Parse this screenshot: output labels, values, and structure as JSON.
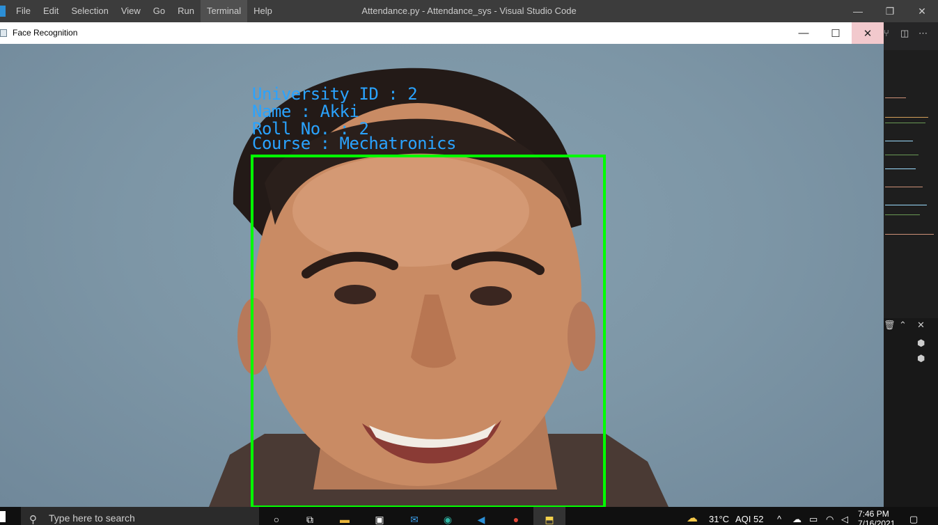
{
  "vscode": {
    "menu": [
      "File",
      "Edit",
      "Selection",
      "View",
      "Go",
      "Run",
      "Terminal",
      "Help"
    ],
    "active_menu": "Terminal",
    "title": "Attendance.py - Attendance_sys - Visual Studio Code",
    "controls": {
      "minimize": "—",
      "maximize": "❐",
      "close": "✕"
    }
  },
  "window": {
    "title": "Face Recognition",
    "controls": {
      "minimize": "—",
      "maximize": "☐",
      "close": "✕"
    }
  },
  "overlay": {
    "university_id": "University ID : 2",
    "name": "Name : Akki",
    "roll_no": "Roll No. : 2",
    "course": "Course : Mechatronics"
  },
  "taskbar": {
    "search_placeholder": "Type here to search",
    "weather": "31°C",
    "aqi": "AQI 52",
    "time": "7:46 PM",
    "date": "7/16/2021"
  },
  "colors": {
    "overlay_text": "#2aa3ff",
    "detection_box": "#00ff00"
  }
}
